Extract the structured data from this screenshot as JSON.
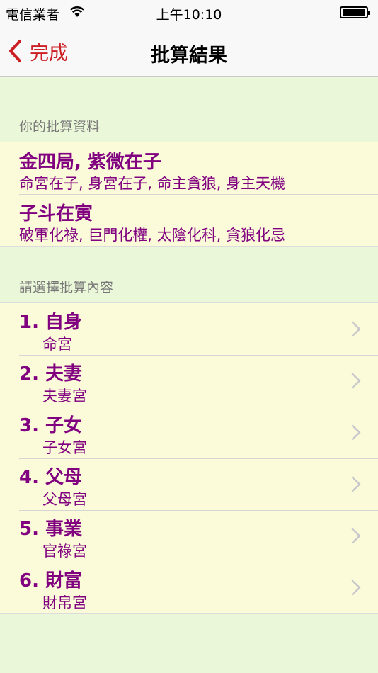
{
  "status_bar": {
    "carrier": "電信業者",
    "time": "上午10:10"
  },
  "nav": {
    "back_label": "完成",
    "title": "批算結果"
  },
  "info_section": {
    "header": "你的批算資料",
    "rows": [
      {
        "title": "金四局, 紫微在子",
        "subtitle": "命宮在子, 身宮在子, 命主貪狼, 身主天機"
      },
      {
        "title": "子斗在寅",
        "subtitle": "破軍化祿, 巨門化權, 太陰化科, 貪狼化忌"
      }
    ]
  },
  "menu_section": {
    "header": "請選擇批算內容",
    "items": [
      {
        "title": "1. 自身",
        "subtitle": "命宮"
      },
      {
        "title": "2. 夫妻",
        "subtitle": "夫妻宮"
      },
      {
        "title": "3. 子女",
        "subtitle": "子女宮"
      },
      {
        "title": "4. 父母",
        "subtitle": "父母宮"
      },
      {
        "title": "5. 事業",
        "subtitle": "官祿宮"
      },
      {
        "title": "6. 財富",
        "subtitle": "財帛宮"
      }
    ]
  },
  "colors": {
    "accent": "#cc1f24",
    "text_purple": "#800080",
    "background": "#ebf7d9",
    "cell_background": "#fbfbd9"
  }
}
